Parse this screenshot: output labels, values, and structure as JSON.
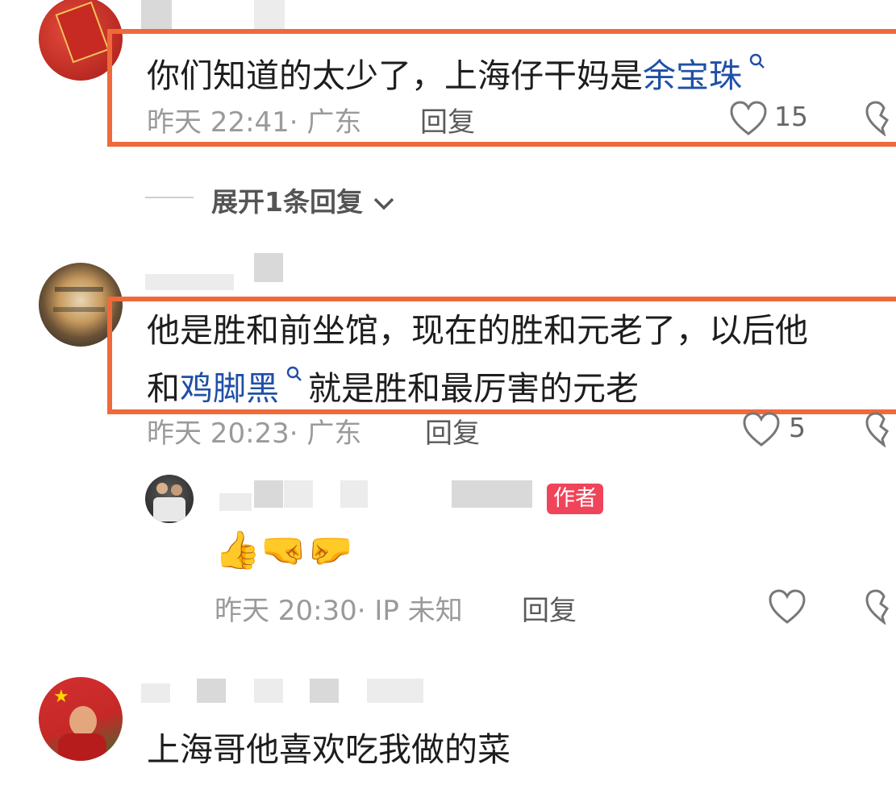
{
  "comments": [
    {
      "text_before": "你们知道的太少了，上海仔干妈是",
      "link_text": "余宝珠",
      "meta": "昨天 22:41· 广东",
      "reply_label": "回复",
      "likes": "15"
    },
    {
      "expand_label": "展开1条回复",
      "expand_chevron": "chevron-down-icon"
    },
    {
      "line1": "他是胜和前坐馆，现在的胜和元老了，以后他",
      "line2_before": "和",
      "link_text": "鸡脚黑",
      "line2_after": "就是胜和最厉害的元老",
      "meta": "昨天 20:23· 广东",
      "reply_label": "回复",
      "likes": "5"
    },
    {
      "author_tag": "作者",
      "emoji": "👍🤜🤛",
      "meta": "昨天 20:30· IP 未知",
      "reply_label": "回复"
    },
    {
      "text": "上海哥他喜欢吃我做的菜"
    }
  ],
  "icons": {
    "like": "heart-icon",
    "dislike": "broken-heart-icon",
    "search": "search-icon"
  },
  "colors": {
    "highlight": "#f0693a",
    "link": "#1f4fa8",
    "author_tag": "#f0445a"
  }
}
